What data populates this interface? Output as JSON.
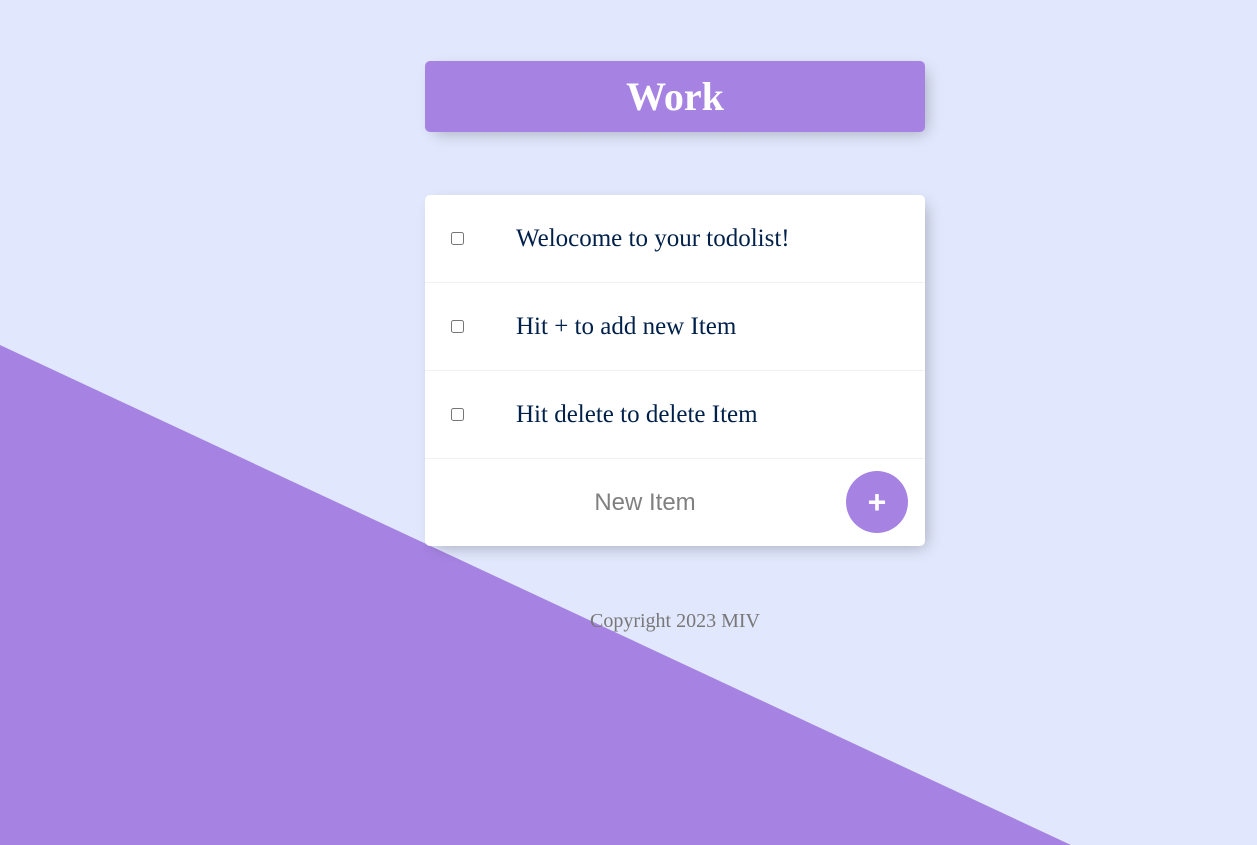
{
  "header": {
    "title": "Work"
  },
  "list": {
    "items": [
      {
        "label": "Welocome to your todolist!",
        "checked": false
      },
      {
        "label": "Hit + to add new Item",
        "checked": false
      },
      {
        "label": "Hit delete to delete Item",
        "checked": false
      }
    ],
    "new_item": {
      "placeholder": "New Item",
      "value": ""
    },
    "add_button_label": "+"
  },
  "footer": {
    "text": "Copyright 2023 MIV"
  },
  "colors": {
    "background": "#E1E7FC",
    "accent": "#A683E3",
    "item_text": "#00204A",
    "footer_text": "#787878"
  }
}
